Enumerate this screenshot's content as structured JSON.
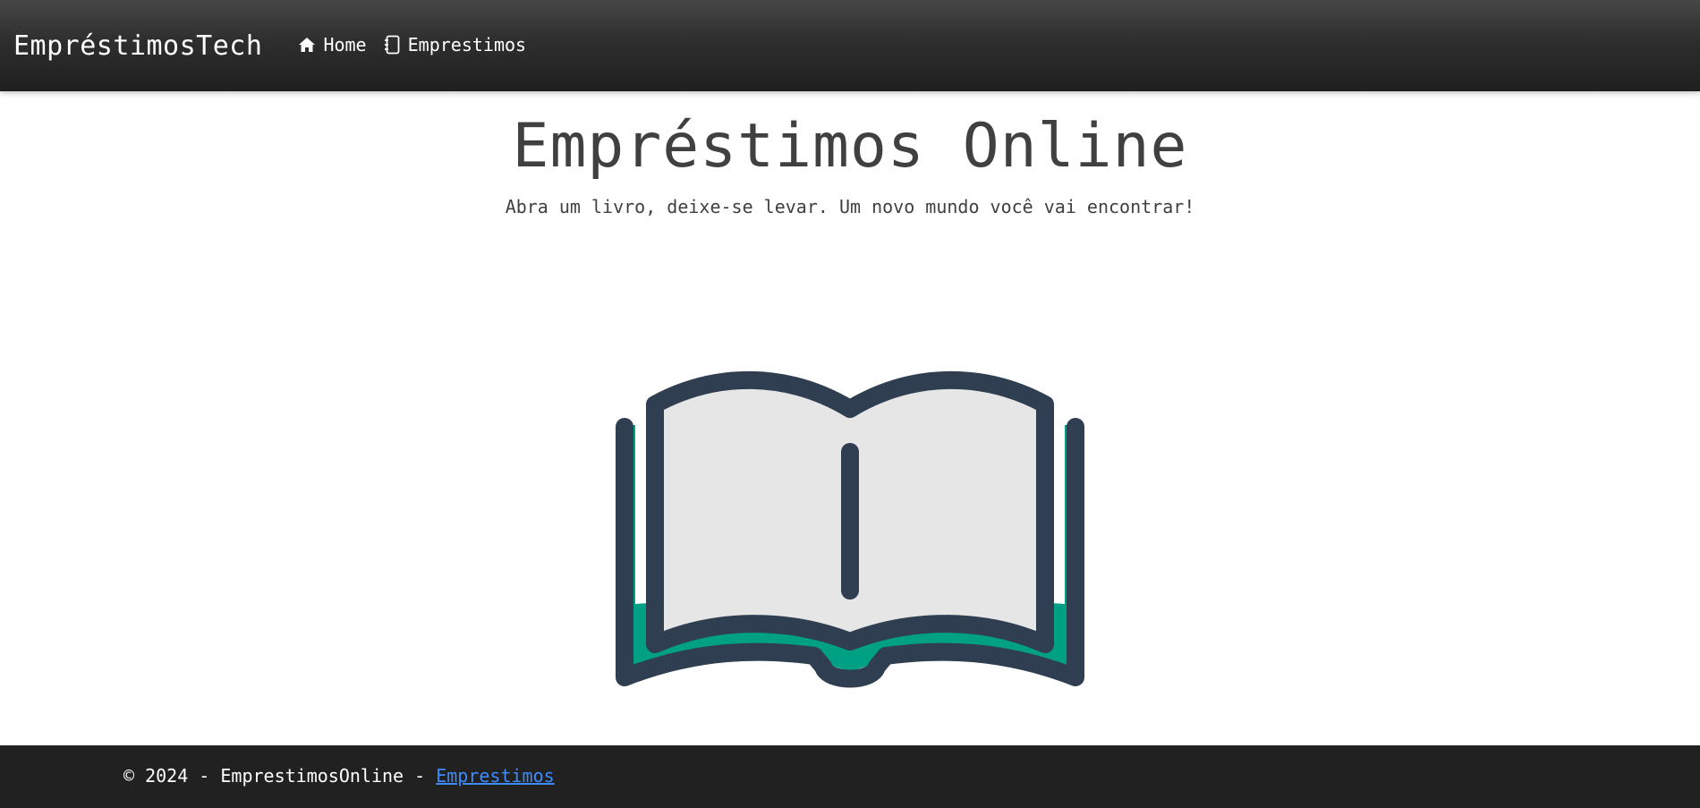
{
  "navbar": {
    "brand": "EmpréstimosTech",
    "links": [
      {
        "label": "Home",
        "icon": "home-icon"
      },
      {
        "label": "Emprestimos",
        "icon": "notebook-icon"
      }
    ]
  },
  "hero": {
    "title": "Empréstimos Online",
    "subtitle": "Abra um livro, deixe-se levar. Um novo mundo você vai encontrar!",
    "illustration": "open-book-icon"
  },
  "footer": {
    "prefix": "© 2024 - EmprestimosOnline -",
    "link_label": "Emprestimos"
  },
  "colors": {
    "navbar": "#2e2e2e",
    "footer": "#212121",
    "text": "#404040",
    "book_outline": "#2f3e50",
    "book_pages": "#e6e6e7",
    "book_cover": "#00a085",
    "link": "#3d8bfd"
  }
}
